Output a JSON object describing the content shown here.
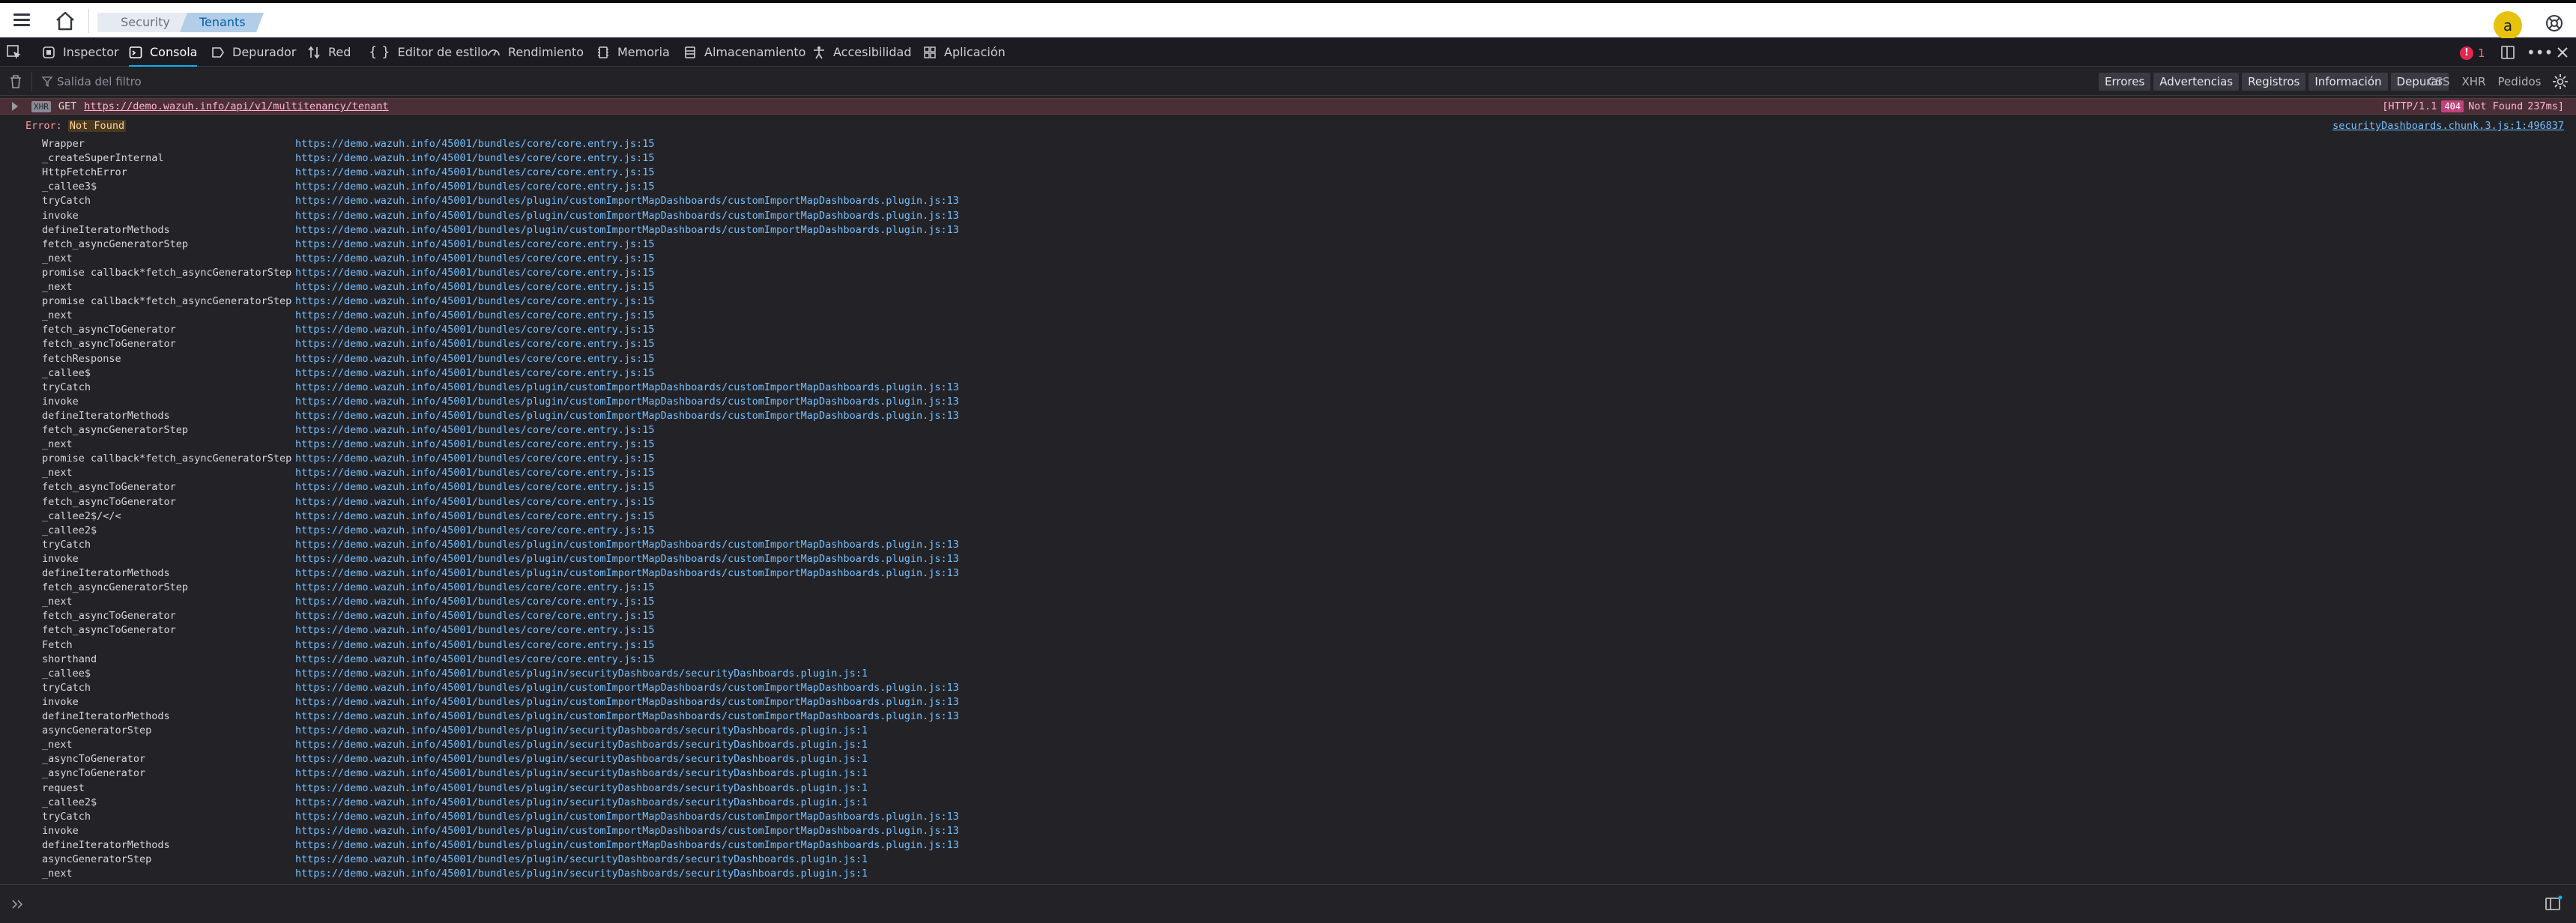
{
  "topbar": {
    "breadcrumbs": [
      "Security",
      "Tenants"
    ],
    "avatar_letter": "a"
  },
  "devtools": {
    "tabs": [
      {
        "label": "Inspector",
        "icon": "inspector-icon"
      },
      {
        "label": "Consola",
        "icon": "console-icon",
        "active": true
      },
      {
        "label": "Depurador",
        "icon": "debugger-icon"
      },
      {
        "label": "Red",
        "icon": "network-icon"
      },
      {
        "label": "Editor de estilo",
        "icon": "style-editor-icon"
      },
      {
        "label": "Rendimiento",
        "icon": "performance-icon"
      },
      {
        "label": "Memoria",
        "icon": "memory-icon"
      },
      {
        "label": "Almacenamiento",
        "icon": "storage-icon"
      },
      {
        "label": "Accesibilidad",
        "icon": "accessibility-icon"
      },
      {
        "label": "Aplicación",
        "icon": "application-icon"
      }
    ],
    "error_count": "1"
  },
  "filterbar": {
    "placeholder": "Salida del filtro",
    "levels": [
      "Errores",
      "Advertencias",
      "Registros",
      "Información",
      "Depurar"
    ],
    "categories": [
      "CSS",
      "XHR",
      "Pedidos"
    ]
  },
  "console": {
    "xhr": {
      "badge": "XHR",
      "method": "GET",
      "url": "https://demo.wazuh.info/api/v1/multitenancy/tenant",
      "http": "[HTTP/1.1",
      "status_code": "404",
      "status_text": "Not Found",
      "time": "237ms]"
    },
    "error": {
      "prefix": "Error:",
      "message": "Not Found",
      "source": "securityDashboards.chunk.3.js:1:496837"
    },
    "frames": [
      {
        "fn": "Wrapper",
        "loc": "https://demo.wazuh.info/45001/bundles/core/core.entry.js:15"
      },
      {
        "fn": "_createSuperInternal",
        "loc": "https://demo.wazuh.info/45001/bundles/core/core.entry.js:15"
      },
      {
        "fn": "HttpFetchError",
        "loc": "https://demo.wazuh.info/45001/bundles/core/core.entry.js:15"
      },
      {
        "fn": "_callee3$",
        "loc": "https://demo.wazuh.info/45001/bundles/core/core.entry.js:15"
      },
      {
        "fn": "tryCatch",
        "loc": "https://demo.wazuh.info/45001/bundles/plugin/customImportMapDashboards/customImportMapDashboards.plugin.js:13"
      },
      {
        "fn": "invoke",
        "loc": "https://demo.wazuh.info/45001/bundles/plugin/customImportMapDashboards/customImportMapDashboards.plugin.js:13"
      },
      {
        "fn": "defineIteratorMethods",
        "loc": "https://demo.wazuh.info/45001/bundles/plugin/customImportMapDashboards/customImportMapDashboards.plugin.js:13"
      },
      {
        "fn": "fetch_asyncGeneratorStep",
        "loc": "https://demo.wazuh.info/45001/bundles/core/core.entry.js:15"
      },
      {
        "fn": "_next",
        "loc": "https://demo.wazuh.info/45001/bundles/core/core.entry.js:15"
      },
      {
        "fn": "promise callback*fetch_asyncGeneratorStep",
        "loc": "https://demo.wazuh.info/45001/bundles/core/core.entry.js:15"
      },
      {
        "fn": "_next",
        "loc": "https://demo.wazuh.info/45001/bundles/core/core.entry.js:15"
      },
      {
        "fn": "promise callback*fetch_asyncGeneratorStep",
        "loc": "https://demo.wazuh.info/45001/bundles/core/core.entry.js:15"
      },
      {
        "fn": "_next",
        "loc": "https://demo.wazuh.info/45001/bundles/core/core.entry.js:15"
      },
      {
        "fn": "fetch_asyncToGenerator",
        "loc": "https://demo.wazuh.info/45001/bundles/core/core.entry.js:15"
      },
      {
        "fn": "fetch_asyncToGenerator",
        "loc": "https://demo.wazuh.info/45001/bundles/core/core.entry.js:15"
      },
      {
        "fn": "fetchResponse",
        "loc": "https://demo.wazuh.info/45001/bundles/core/core.entry.js:15"
      },
      {
        "fn": "_callee$",
        "loc": "https://demo.wazuh.info/45001/bundles/core/core.entry.js:15"
      },
      {
        "fn": "tryCatch",
        "loc": "https://demo.wazuh.info/45001/bundles/plugin/customImportMapDashboards/customImportMapDashboards.plugin.js:13"
      },
      {
        "fn": "invoke",
        "loc": "https://demo.wazuh.info/45001/bundles/plugin/customImportMapDashboards/customImportMapDashboards.plugin.js:13"
      },
      {
        "fn": "defineIteratorMethods",
        "loc": "https://demo.wazuh.info/45001/bundles/plugin/customImportMapDashboards/customImportMapDashboards.plugin.js:13"
      },
      {
        "fn": "fetch_asyncGeneratorStep",
        "loc": "https://demo.wazuh.info/45001/bundles/core/core.entry.js:15"
      },
      {
        "fn": "_next",
        "loc": "https://demo.wazuh.info/45001/bundles/core/core.entry.js:15"
      },
      {
        "fn": "promise callback*fetch_asyncGeneratorStep",
        "loc": "https://demo.wazuh.info/45001/bundles/core/core.entry.js:15"
      },
      {
        "fn": "_next",
        "loc": "https://demo.wazuh.info/45001/bundles/core/core.entry.js:15"
      },
      {
        "fn": "fetch_asyncToGenerator",
        "loc": "https://demo.wazuh.info/45001/bundles/core/core.entry.js:15"
      },
      {
        "fn": "fetch_asyncToGenerator",
        "loc": "https://demo.wazuh.info/45001/bundles/core/core.entry.js:15"
      },
      {
        "fn": "_callee2$/</<",
        "loc": "https://demo.wazuh.info/45001/bundles/core/core.entry.js:15"
      },
      {
        "fn": "_callee2$",
        "loc": "https://demo.wazuh.info/45001/bundles/core/core.entry.js:15"
      },
      {
        "fn": "tryCatch",
        "loc": "https://demo.wazuh.info/45001/bundles/plugin/customImportMapDashboards/customImportMapDashboards.plugin.js:13"
      },
      {
        "fn": "invoke",
        "loc": "https://demo.wazuh.info/45001/bundles/plugin/customImportMapDashboards/customImportMapDashboards.plugin.js:13"
      },
      {
        "fn": "defineIteratorMethods",
        "loc": "https://demo.wazuh.info/45001/bundles/plugin/customImportMapDashboards/customImportMapDashboards.plugin.js:13"
      },
      {
        "fn": "fetch_asyncGeneratorStep",
        "loc": "https://demo.wazuh.info/45001/bundles/core/core.entry.js:15"
      },
      {
        "fn": "_next",
        "loc": "https://demo.wazuh.info/45001/bundles/core/core.entry.js:15"
      },
      {
        "fn": "fetch_asyncToGenerator",
        "loc": "https://demo.wazuh.info/45001/bundles/core/core.entry.js:15"
      },
      {
        "fn": "fetch_asyncToGenerator",
        "loc": "https://demo.wazuh.info/45001/bundles/core/core.entry.js:15"
      },
      {
        "fn": "Fetch",
        "loc": "https://demo.wazuh.info/45001/bundles/core/core.entry.js:15"
      },
      {
        "fn": "shorthand",
        "loc": "https://demo.wazuh.info/45001/bundles/core/core.entry.js:15"
      },
      {
        "fn": "_callee$",
        "loc": "https://demo.wazuh.info/45001/bundles/plugin/securityDashboards/securityDashboards.plugin.js:1"
      },
      {
        "fn": "tryCatch",
        "loc": "https://demo.wazuh.info/45001/bundles/plugin/customImportMapDashboards/customImportMapDashboards.plugin.js:13"
      },
      {
        "fn": "invoke",
        "loc": "https://demo.wazuh.info/45001/bundles/plugin/customImportMapDashboards/customImportMapDashboards.plugin.js:13"
      },
      {
        "fn": "defineIteratorMethods",
        "loc": "https://demo.wazuh.info/45001/bundles/plugin/customImportMapDashboards/customImportMapDashboards.plugin.js:13"
      },
      {
        "fn": "asyncGeneratorStep",
        "loc": "https://demo.wazuh.info/45001/bundles/plugin/securityDashboards/securityDashboards.plugin.js:1"
      },
      {
        "fn": "_next",
        "loc": "https://demo.wazuh.info/45001/bundles/plugin/securityDashboards/securityDashboards.plugin.js:1"
      },
      {
        "fn": "_asyncToGenerator",
        "loc": "https://demo.wazuh.info/45001/bundles/plugin/securityDashboards/securityDashboards.plugin.js:1"
      },
      {
        "fn": "_asyncToGenerator",
        "loc": "https://demo.wazuh.info/45001/bundles/plugin/securityDashboards/securityDashboards.plugin.js:1"
      },
      {
        "fn": "request",
        "loc": "https://demo.wazuh.info/45001/bundles/plugin/securityDashboards/securityDashboards.plugin.js:1"
      },
      {
        "fn": "_callee2$",
        "loc": "https://demo.wazuh.info/45001/bundles/plugin/securityDashboards/securityDashboards.plugin.js:1"
      },
      {
        "fn": "tryCatch",
        "loc": "https://demo.wazuh.info/45001/bundles/plugin/customImportMapDashboards/customImportMapDashboards.plugin.js:13"
      },
      {
        "fn": "invoke",
        "loc": "https://demo.wazuh.info/45001/bundles/plugin/customImportMapDashboards/customImportMapDashboards.plugin.js:13"
      },
      {
        "fn": "defineIteratorMethods",
        "loc": "https://demo.wazuh.info/45001/bundles/plugin/customImportMapDashboards/customImportMapDashboards.plugin.js:13"
      },
      {
        "fn": "asyncGeneratorStep",
        "loc": "https://demo.wazuh.info/45001/bundles/plugin/securityDashboards/securityDashboards.plugin.js:1"
      },
      {
        "fn": "_next",
        "loc": "https://demo.wazuh.info/45001/bundles/plugin/securityDashboards/securityDashboards.plugin.js:1"
      }
    ]
  },
  "colors": {
    "accent": "#00b3f4",
    "error_row_bg": "#4b2f36",
    "link": "#75bfff",
    "avatar": "#e7c20e"
  }
}
